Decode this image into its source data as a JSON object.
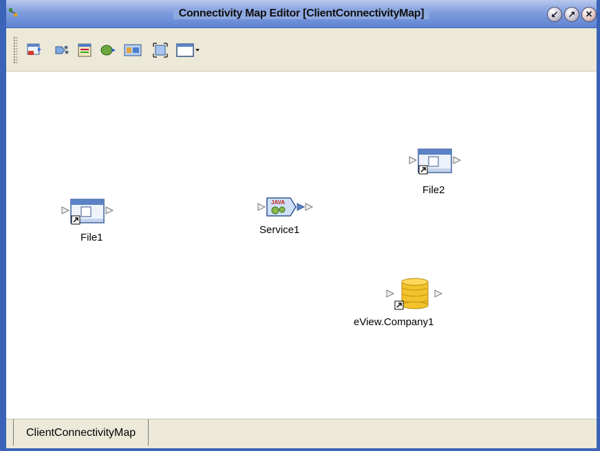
{
  "window": {
    "title": "Connectivity Map Editor [ClientConnectivityMap]",
    "controls": [
      "restore",
      "maximize",
      "close"
    ]
  },
  "toolbar": {
    "tools": [
      {
        "name": "add-external-application-icon"
      },
      {
        "name": "add-service-icon"
      },
      {
        "name": "add-collaboration-icon"
      },
      {
        "name": "add-topic-icon"
      },
      {
        "name": "add-web-connector-icon"
      },
      {
        "name": "fit-to-screen-icon"
      },
      {
        "name": "view-options-icon"
      }
    ]
  },
  "nodes": {
    "file1": {
      "label": "File1",
      "icon": "file-external-icon"
    },
    "service1": {
      "label": "Service1",
      "icon": "java-service-icon"
    },
    "file2": {
      "label": "File2",
      "icon": "file-external-icon"
    },
    "eview": {
      "label": "eView.Company1",
      "icon": "database-icon"
    }
  },
  "tabs": [
    {
      "label": "ClientConnectivityMap",
      "active": true
    }
  ],
  "colors": {
    "frame": "#3b64b8",
    "titlebar": "#7f9dde",
    "toolbar": "#ece9d8",
    "canvas": "#ffffff"
  }
}
